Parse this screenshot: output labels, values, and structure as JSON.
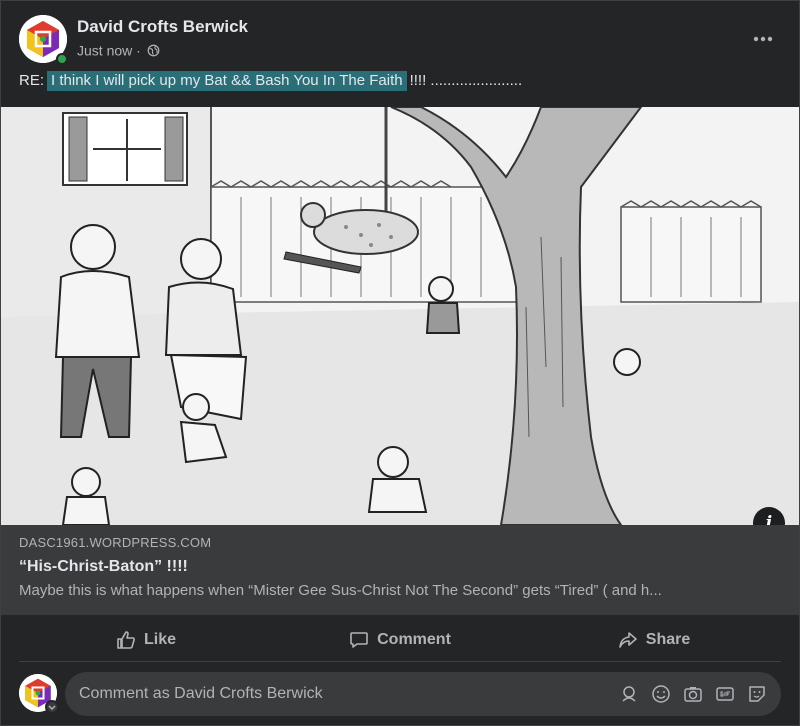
{
  "post": {
    "author": "David Crofts Berwick",
    "time": "Just now",
    "separator": "·",
    "message_prefix": "RE:",
    "message_highlight": "I think I will pick up my Bat && Bash You In The Faith",
    "message_suffix": "!!!! ......................"
  },
  "image": {
    "icon": "cartoon-illustration"
  },
  "preview": {
    "domain": "DASC1961.WORDPRESS.COM",
    "title": "“His-Christ-Baton” !!!!",
    "description": "Maybe this is what happens when “Mister Gee Sus-Christ Not The Second” gets “Tired” ( and h..."
  },
  "actions": {
    "like": "Like",
    "comment": "Comment",
    "share": "Share"
  },
  "composer": {
    "placeholder": "Comment as David Crofts Berwick",
    "icons": [
      "avatar-sticker-icon",
      "emoji-icon",
      "camera-icon",
      "gif-icon",
      "sticker-icon"
    ]
  },
  "colors": {
    "background": "#242526",
    "preview_bg": "#3a3b3c",
    "highlight": "#2a6f78",
    "text_primary": "#e4e6eb",
    "text_secondary": "#b0b3b8",
    "online": "#31a24c"
  }
}
